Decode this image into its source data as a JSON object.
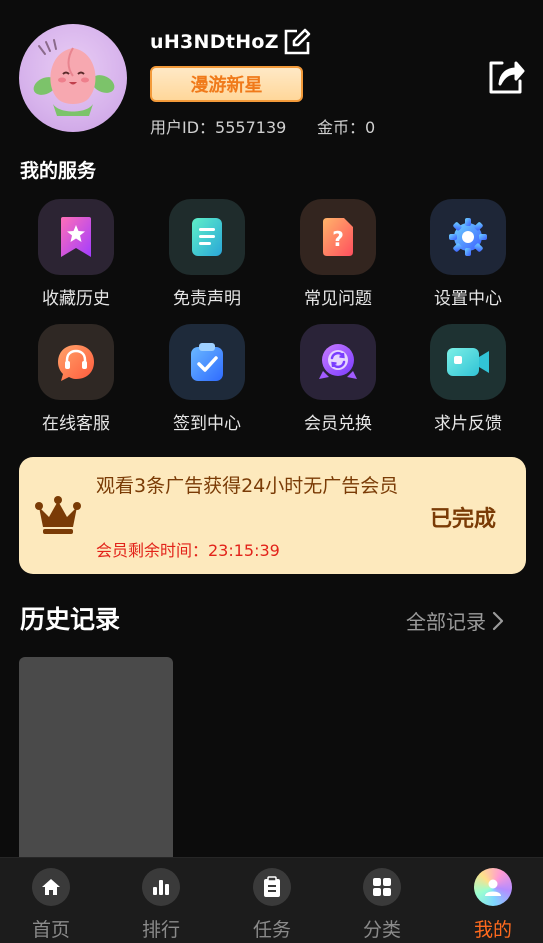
{
  "profile": {
    "username": "uH3NDtHoZ",
    "level_badge": "漫游新星",
    "user_id": "用户ID：5557139",
    "coins": "金币：0"
  },
  "services": {
    "title": "我的服务",
    "items": [
      {
        "label": "收藏历史",
        "icon": "bookmark-star-icon"
      },
      {
        "label": "免责声明",
        "icon": "document-icon"
      },
      {
        "label": "常见问题",
        "icon": "question-document-icon"
      },
      {
        "label": "设置中心",
        "icon": "gear-icon"
      },
      {
        "label": "在线客服",
        "icon": "headset-chat-icon"
      },
      {
        "label": "签到中心",
        "icon": "check-clipboard-icon"
      },
      {
        "label": "会员兑换",
        "icon": "exchange-badge-icon"
      },
      {
        "label": "求片反馈",
        "icon": "video-camera-icon"
      }
    ]
  },
  "ad_banner": {
    "message": "观看3条广告获得24小时无广告会员",
    "timer": "会员剩余时间：23:15:39",
    "status": "已完成"
  },
  "history": {
    "title": "历史记录",
    "all_link": "全部记录"
  },
  "tabbar": {
    "items": [
      {
        "label": "首页",
        "icon": "home-icon"
      },
      {
        "label": "排行",
        "icon": "bar-chart-icon"
      },
      {
        "label": "任务",
        "icon": "clipboard-icon"
      },
      {
        "label": "分类",
        "icon": "grid-icon"
      },
      {
        "label": "我的",
        "icon": "avatar-icon"
      }
    ],
    "active_index": 4
  },
  "colors": {
    "accent": "#ff6a1e",
    "banner_bg": "#fde9bd",
    "badge_text": "#f07a1a",
    "timer_red": "#e2231a"
  }
}
